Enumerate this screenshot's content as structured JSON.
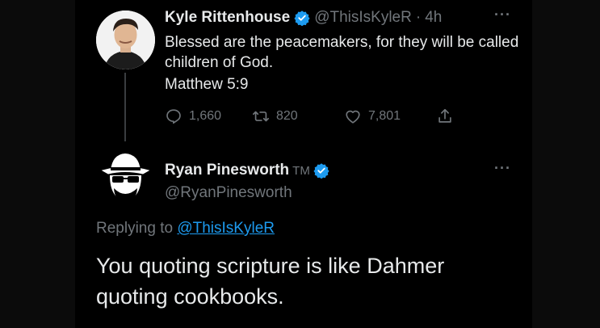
{
  "tweet1": {
    "author_name": "Kyle Rittenhouse",
    "handle": "@ThisIsKyleR",
    "separator": "·",
    "time": "4h",
    "text": "Blessed are the peacemakers, for they will be called children of God.",
    "reference": "Matthew 5:9",
    "replies": "1,660",
    "retweets": "820",
    "likes": "7,801",
    "more": "···"
  },
  "tweet2": {
    "author_name": "Ryan Pinesworth",
    "tm": "TM",
    "handle": "@RyanPinesworth",
    "more": "···",
    "replying_prefix": "Replying to",
    "replying_handle": "@ThisIsKyleR",
    "text": "You quoting scripture is like Dahmer quoting cookbooks."
  },
  "icons": {
    "verified": "verified-badge-icon",
    "reply": "reply-icon",
    "retweet": "retweet-icon",
    "like": "heart-icon",
    "share": "share-icon"
  },
  "colors": {
    "background": "#000000",
    "text": "#e7e9ea",
    "muted": "#71767b",
    "accent": "#1d9bf0"
  }
}
